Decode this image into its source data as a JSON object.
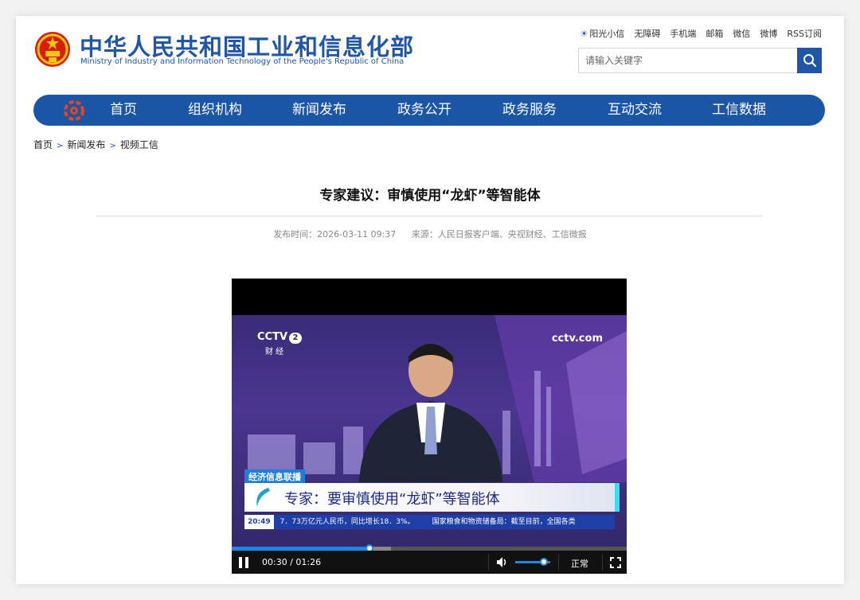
{
  "header": {
    "title_cn": "中华人民共和国工业和信息化部",
    "title_en": "Ministry of Industry and Information Technology of the People's Republic of China",
    "links": [
      "阳光小信",
      "无障碍",
      "手机端",
      "邮箱",
      "微信",
      "微博",
      "RSS订阅"
    ],
    "search_placeholder": "请输入关键字"
  },
  "nav": {
    "items": [
      "首页",
      "组织机构",
      "新闻发布",
      "政务公开",
      "政务服务",
      "互动交流",
      "工信数据"
    ]
  },
  "breadcrumb": [
    "首页",
    "新闻发布",
    "视频工信"
  ],
  "breadcrumb_sep": ">",
  "article": {
    "title": "专家建议：审慎使用“龙虾”等智能体",
    "published": "发布时间：2026-03-11 09:37",
    "source": "来源：人民日报客户端、央视财经、工信微报"
  },
  "video": {
    "channel_logo": "CCTV",
    "channel_num": "2",
    "channel_name": "财 经",
    "site_logo": "cctv.com",
    "program_tag": "经济信息联播",
    "headline": "专家：要审慎使用“龙虾”等智能体",
    "ticker_time": "20:49",
    "ticker_text_1": "7．73万亿元人民币，同比增长18．3%。",
    "ticker_text_2": "国家粮食和物资储备局：截至目前，全国各类",
    "timecode": "00:30 / 01:26",
    "progress": 0.349,
    "buffered": 0.403,
    "volume": 0.82,
    "speed_label": "正常"
  },
  "colors": {
    "brand_blue": "#1f56a8",
    "nav_blue": "#1b55a6",
    "player_accent": "#1e88e5"
  }
}
